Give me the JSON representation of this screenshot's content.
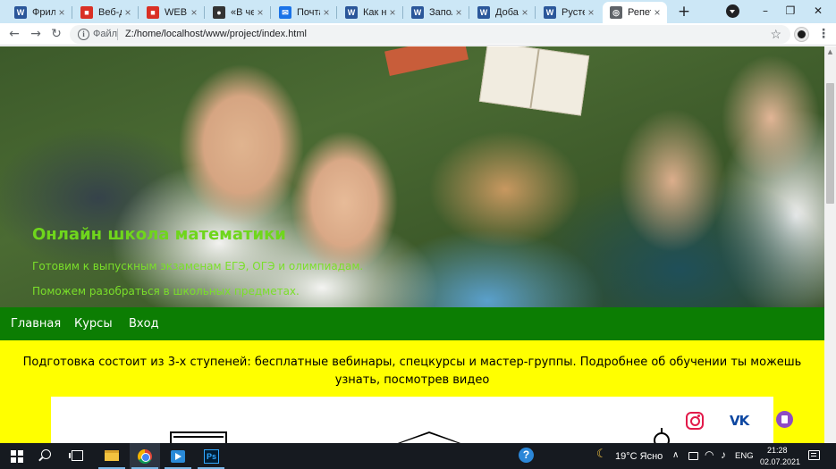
{
  "browser": {
    "tabs": [
      {
        "label": "Фрила",
        "favicon": "word-icon",
        "color": "#2b579a",
        "glyph": "W"
      },
      {
        "label": "Веб-ди",
        "favicon": "red-square-icon",
        "color": "#d93025",
        "glyph": "■"
      },
      {
        "label": "WEB ва",
        "favicon": "red-square-icon",
        "color": "#d93025",
        "glyph": "■"
      },
      {
        "label": "«В чем",
        "favicon": "dark-circle-icon",
        "color": "#333333",
        "glyph": "●"
      },
      {
        "label": "Почта",
        "favicon": "mail-icon",
        "color": "#1a73e8",
        "glyph": "✉"
      },
      {
        "label": "Как на",
        "favicon": "word-icon",
        "color": "#2b579a",
        "glyph": "W"
      },
      {
        "label": "Запол",
        "favicon": "word-icon",
        "color": "#2b579a",
        "glyph": "W"
      },
      {
        "label": "Добав",
        "favicon": "word-icon",
        "color": "#2b579a",
        "glyph": "W"
      },
      {
        "label": "Рустем",
        "favicon": "word-icon",
        "color": "#2b579a",
        "glyph": "W"
      },
      {
        "label": "Репети",
        "favicon": "globe-icon",
        "color": "#5f6368",
        "glyph": "◎",
        "active": true
      }
    ],
    "tab_close_glyph": "×",
    "new_tab_glyph": "+",
    "window_controls": {
      "minimize": "–",
      "restore": "❐",
      "close": "✕"
    },
    "address": {
      "prefix": "Файл",
      "url": "Z:/home/localhost/www/project/index.html"
    },
    "nav_glyphs": {
      "back": "←",
      "forward": "→",
      "reload": "↻",
      "star": "☆",
      "menu": "⋮"
    }
  },
  "page": {
    "hero": {
      "title": "Онлайн школа математики",
      "subtitle_1": "Готовим к выпускным экзаменам ЕГЭ, ОГЭ и олимпиадам.",
      "subtitle_2": "Поможем разобраться в школьных предметах.",
      "text_color": "#6fd61c"
    },
    "nav": {
      "items": [
        "Главная",
        "Курсы",
        "Вход"
      ],
      "background": "#0c7d03"
    },
    "info": {
      "text": "Подготовка состоит из 3-х ступеней: бесплатные вебинары, спецкурсы и мастер-группы. Подробнее об обучении ты можешь узнать, посмотрев видео",
      "background": "#ffff00"
    },
    "social": {
      "vk_label": "VK",
      "icons": [
        "instagram-icon",
        "vk-icon",
        "viber-icon"
      ]
    }
  },
  "taskbar": {
    "apps": [
      "file-explorer-icon",
      "chrome-icon",
      "video-player-icon",
      "photoshop-icon"
    ],
    "ps_label": "Ps",
    "help_label": "?",
    "weather": "19°C Ясно",
    "weather_glyph": "☾",
    "tray_chevron": "∧",
    "net_glyph": "◠",
    "vol_glyph": "♪",
    "language": "ENG",
    "time": "21:28",
    "date": "02.07.2021"
  }
}
